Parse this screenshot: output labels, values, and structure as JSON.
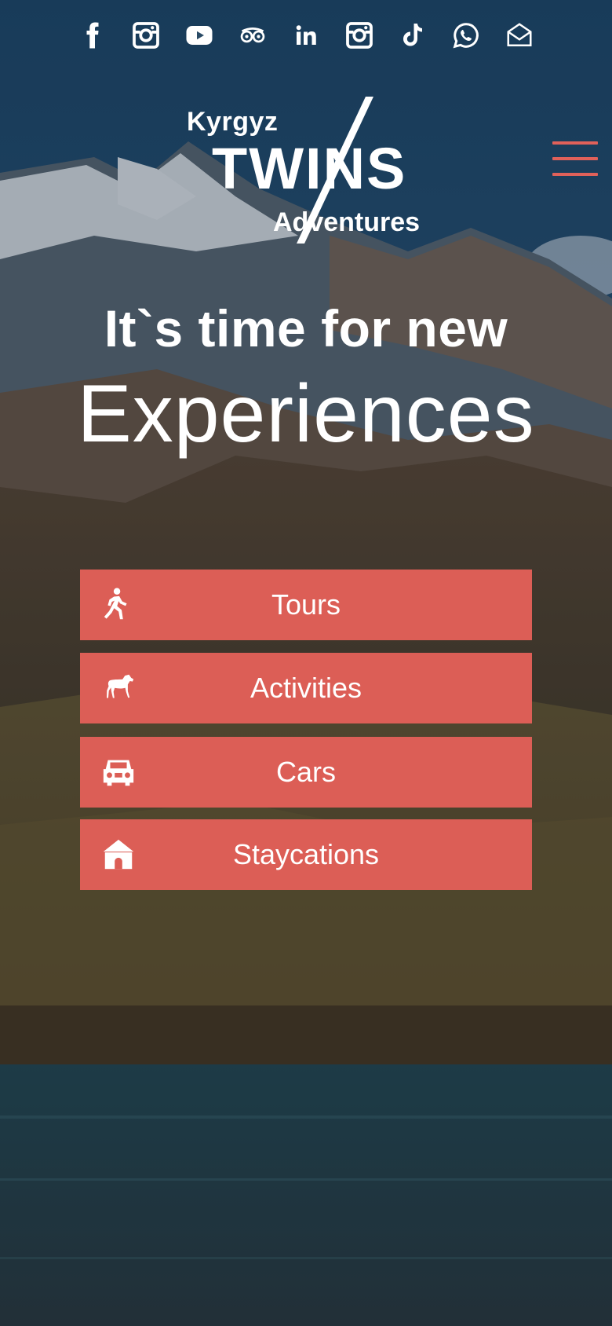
{
  "social": {
    "icons": [
      "facebook-icon",
      "instagram-icon",
      "youtube-icon",
      "tripadvisor-icon",
      "linkedin-icon",
      "instagram-icon",
      "tiktok-icon",
      "whatsapp-icon",
      "email-icon"
    ]
  },
  "logo": {
    "line1": "Kyrgyz",
    "line2": "TWINS",
    "line3": "Adventures"
  },
  "hero": {
    "title_line1": "It`s time for new",
    "title_line2": "Experiences"
  },
  "buttons": [
    {
      "label": "Tours",
      "icon": "hiker-icon"
    },
    {
      "label": "Activities",
      "icon": "horse-icon"
    },
    {
      "label": "Cars",
      "icon": "jeep-icon"
    },
    {
      "label": "Staycations",
      "icon": "house-icon"
    }
  ],
  "colors": {
    "accent": "#dc5e56",
    "menu": "#e0615a"
  }
}
